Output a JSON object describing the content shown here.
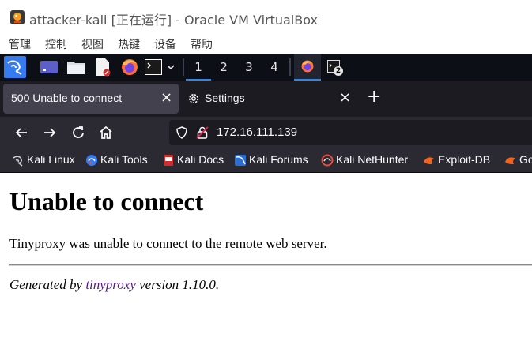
{
  "window": {
    "title": "attacker-kali [正在运行] - Oracle VM VirtualBox",
    "menu": [
      "管理",
      "控制",
      "视图",
      "热键",
      "设备",
      "帮助"
    ]
  },
  "panel": {
    "workspaces": [
      "1",
      "2",
      "3",
      "4"
    ],
    "active_workspace": "1",
    "terminal_badge": "2",
    "accent": "#3584e4"
  },
  "tabs": [
    {
      "label": "500 Unable to connect",
      "active": true
    },
    {
      "label": "Settings",
      "active": false
    }
  ],
  "new_tab_label": "+",
  "address": {
    "url": "172.16.111.139"
  },
  "bookmarks": [
    {
      "label": "Kali Linux",
      "icon": "kali-dragon-icon"
    },
    {
      "label": "Kali Tools",
      "icon": "kali-tools-icon"
    },
    {
      "label": "Kali Docs",
      "icon": "kali-docs-icon"
    },
    {
      "label": "Kali Forums",
      "icon": "kali-forums-icon"
    },
    {
      "label": "Kali NetHunter",
      "icon": "nethunter-icon"
    },
    {
      "label": "Exploit-DB",
      "icon": "exploit-db-icon"
    },
    {
      "label": "Go",
      "icon": "ghdb-icon"
    }
  ],
  "page": {
    "heading": "Unable to connect",
    "message": "Tinyproxy was unable to connect to the remote web server.",
    "footer_prefix": "Generated by",
    "footer_link": "tinyproxy",
    "footer_suffix": "version 1.10.0."
  }
}
